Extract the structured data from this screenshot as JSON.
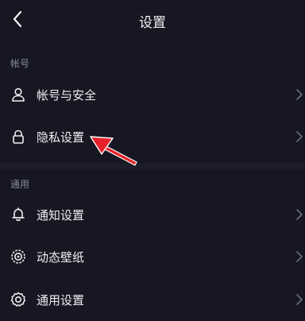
{
  "header": {
    "title": "设置",
    "back_icon": "chevron-left-icon"
  },
  "sections": {
    "account": {
      "label": "帐号",
      "items": [
        {
          "label": "帐号与安全",
          "icon": "user-icon"
        },
        {
          "label": "隐私设置",
          "icon": "lock-icon"
        }
      ]
    },
    "general": {
      "label": "通用",
      "items": [
        {
          "label": "通知设置",
          "icon": "bell-icon"
        },
        {
          "label": "动态壁纸",
          "icon": "wallpaper-icon"
        },
        {
          "label": "通用设置",
          "icon": "gear-icon"
        }
      ]
    }
  },
  "annotation": {
    "color": "#e8202a",
    "icon": "red-arrow-icon"
  },
  "colors": {
    "background": "#161722",
    "text": "#eeeef1",
    "section_label": "#8a8b93",
    "chevron": "#6d6e78"
  }
}
